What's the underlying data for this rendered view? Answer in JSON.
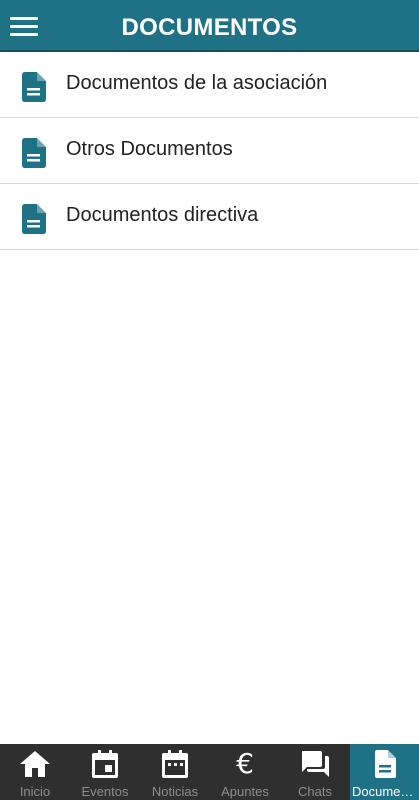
{
  "header": {
    "title": "DOCUMENTOS",
    "menu_icon": "hamburger-menu-icon"
  },
  "documents": {
    "items": [
      {
        "label": "Documentos de la asociación",
        "icon": "document-icon"
      },
      {
        "label": "Otros Documentos",
        "icon": "document-icon"
      },
      {
        "label": "Documentos directiva",
        "icon": "document-icon"
      }
    ]
  },
  "tabbar": {
    "tabs": [
      {
        "label": "Inicio",
        "icon": "home-icon",
        "active": false
      },
      {
        "label": "Eventos",
        "icon": "calendar-event-icon",
        "active": false
      },
      {
        "label": "Noticias",
        "icon": "calendar-icon",
        "active": false
      },
      {
        "label": "Apuntes",
        "icon": "euro-icon",
        "active": false
      },
      {
        "label": "Chats",
        "icon": "chat-icon",
        "active": false
      },
      {
        "label": "Documentos",
        "icon": "document-icon",
        "active": true
      }
    ]
  },
  "colors": {
    "primary": "#1f7285",
    "tabbar_bg": "#2f2f2f",
    "inactive_label": "#8e8e8e",
    "text": "#222222"
  }
}
